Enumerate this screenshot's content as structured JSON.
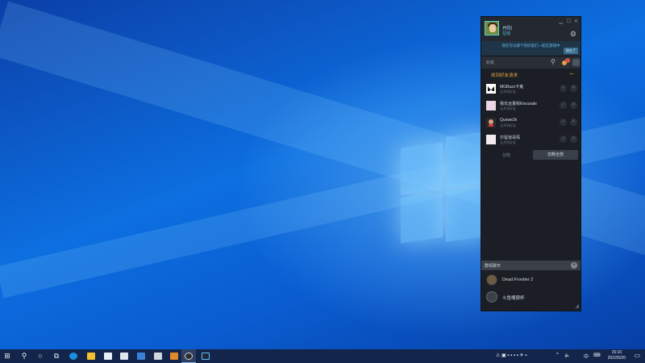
{
  "steam": {
    "profile": {
      "name": "丹阳",
      "status": "在线"
    },
    "window_controls": {
      "minimize": "▁",
      "restore": "☐",
      "close": "✕"
    },
    "banner": {
      "text": "现在可与那个有好友们一起在游戏中",
      "button": "现在了"
    },
    "friends_label": "好友",
    "requests_title": "收到好友请求",
    "back_arrow": "←",
    "requests": [
      {
        "name": "MGBazz卡鬼",
        "sub": "无共同好友"
      },
      {
        "name": "我长远書街Kiezuraki",
        "sub": "无共同好友"
      },
      {
        "name": "Quowe2k",
        "sub": "无共同好友"
      },
      {
        "name": "尔留道哥情",
        "sub": "无共同好友"
      }
    ],
    "accept_glyph": "✓",
    "ignore_glyph": "✕",
    "ignore_all": "忽略",
    "accept_all": "忽略全部",
    "groups_label": "群组聊天",
    "groups_add": "+",
    "groups": [
      {
        "name": "Dead Frontier 2"
      },
      {
        "name": "斗鱼嘴狼杯"
      }
    ]
  },
  "taskbar": {
    "start_icon": "⊞",
    "search_icon": "⚲",
    "cortana_icon": "○",
    "taskview_icon": "⧉",
    "tray_lang": "中",
    "tray_arrow": "^",
    "clock_time": "15:10",
    "clock_date": "2022/5/20",
    "notification_icon": "▭"
  },
  "colors": {
    "steam_bg": "#1b1e25",
    "steam_accent": "#57cbde",
    "request_title": "#e2a640",
    "taskbar_bg": "#13254a"
  }
}
